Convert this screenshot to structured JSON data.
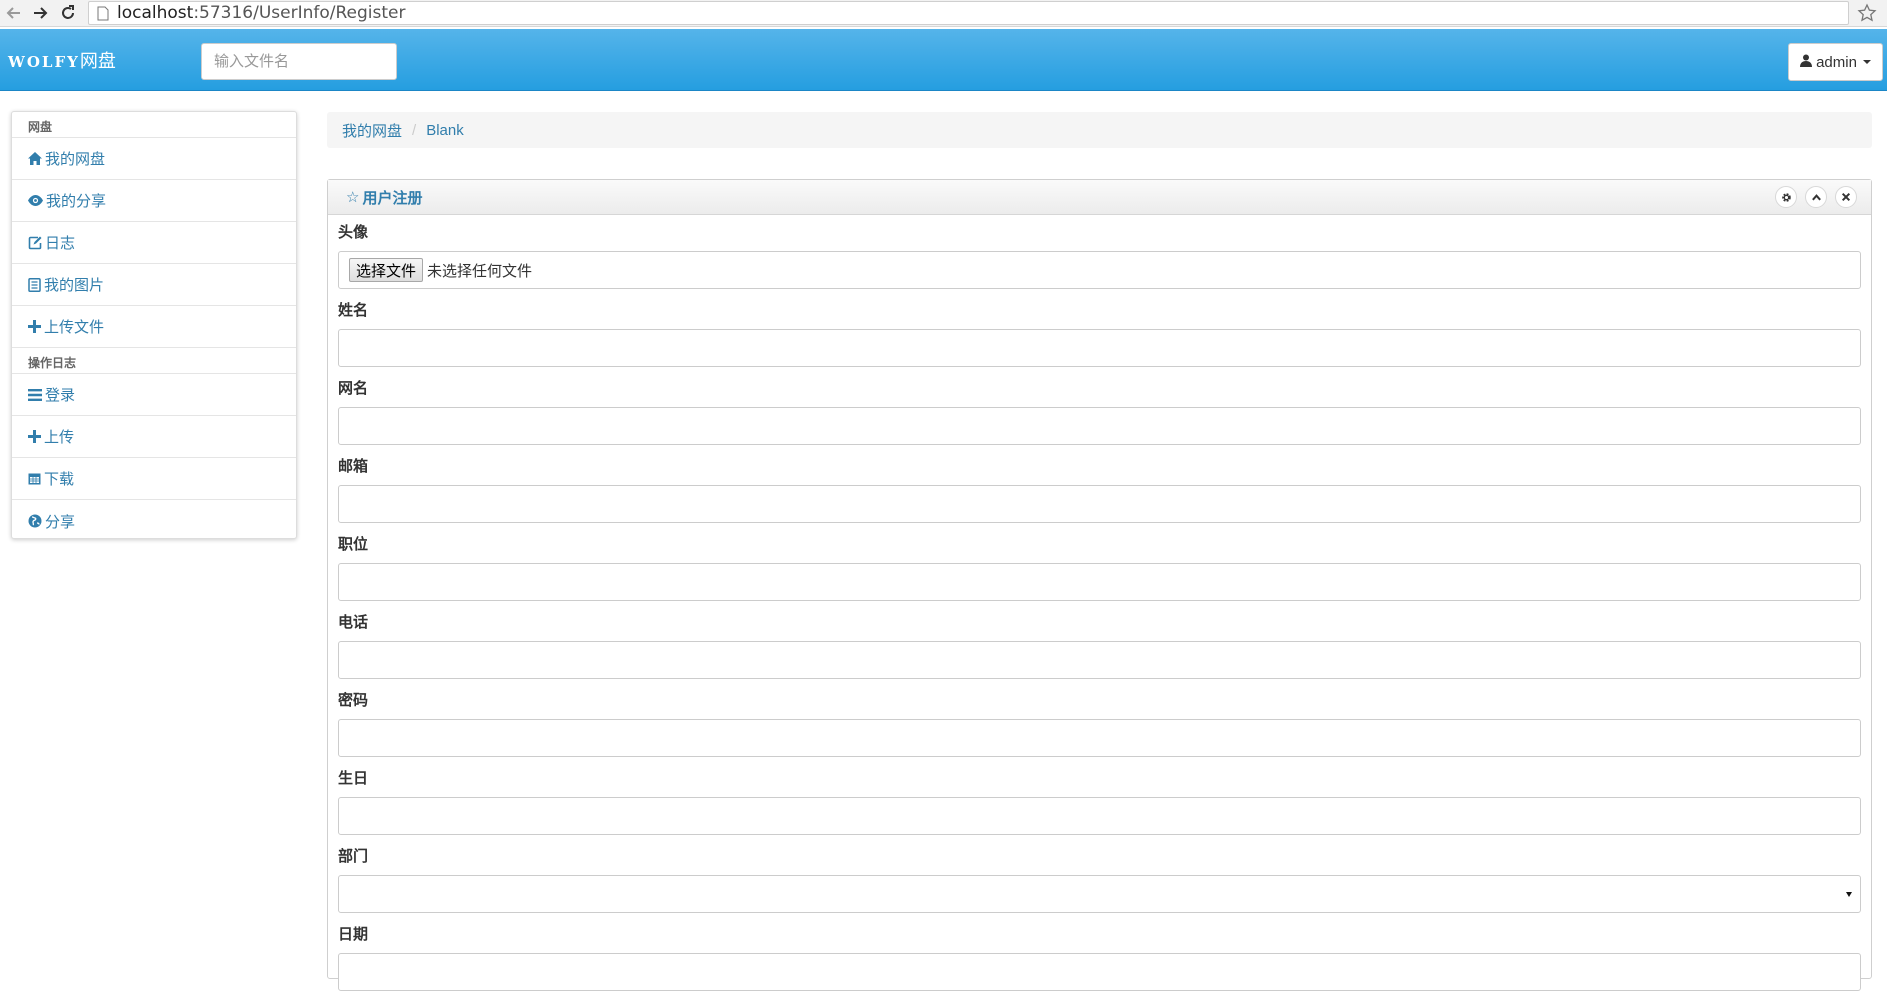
{
  "browser": {
    "url_host": "localhost",
    "url_path": ":57316/UserInfo/Register"
  },
  "navbar": {
    "brand_latin": "WOLFY",
    "brand_cn": "网盘",
    "search_placeholder": "输入文件名",
    "user_label": "admin"
  },
  "sidebar": {
    "sections": [
      {
        "header": "网盘",
        "items": [
          {
            "label": "我的网盘",
            "icon": "home-icon"
          },
          {
            "label": "我的分享",
            "icon": "eye-icon"
          },
          {
            "label": "日志",
            "icon": "edit-icon"
          },
          {
            "label": "我的图片",
            "icon": "book-icon"
          },
          {
            "label": "上传文件",
            "icon": "plus-icon"
          }
        ]
      },
      {
        "header": "操作日志",
        "items": [
          {
            "label": "登录",
            "icon": "list-icon"
          },
          {
            "label": "上传",
            "icon": "plus-icon"
          },
          {
            "label": "下载",
            "icon": "calendar-icon"
          },
          {
            "label": "分享",
            "icon": "globe-icon"
          }
        ]
      }
    ]
  },
  "breadcrumb": {
    "items": [
      "我的网盘",
      "Blank"
    ],
    "separator": "/"
  },
  "panel": {
    "title_icon": "☆",
    "title": "用户注册",
    "tools": [
      "cog-icon",
      "chevron-up-icon",
      "close-icon"
    ]
  },
  "form": {
    "avatar_label": "头像",
    "file_button": "选择文件",
    "file_status": "未选择任何文件",
    "name_label": "姓名",
    "nickname_label": "网名",
    "email_label": "邮箱",
    "position_label": "职位",
    "phone_label": "电话",
    "password_label": "密码",
    "birthday_label": "生日",
    "department_label": "部门",
    "date_label": "日期"
  },
  "colors": {
    "navbar_top": "#55b4ea",
    "navbar_bottom": "#259ee0",
    "link": "#317eac"
  }
}
